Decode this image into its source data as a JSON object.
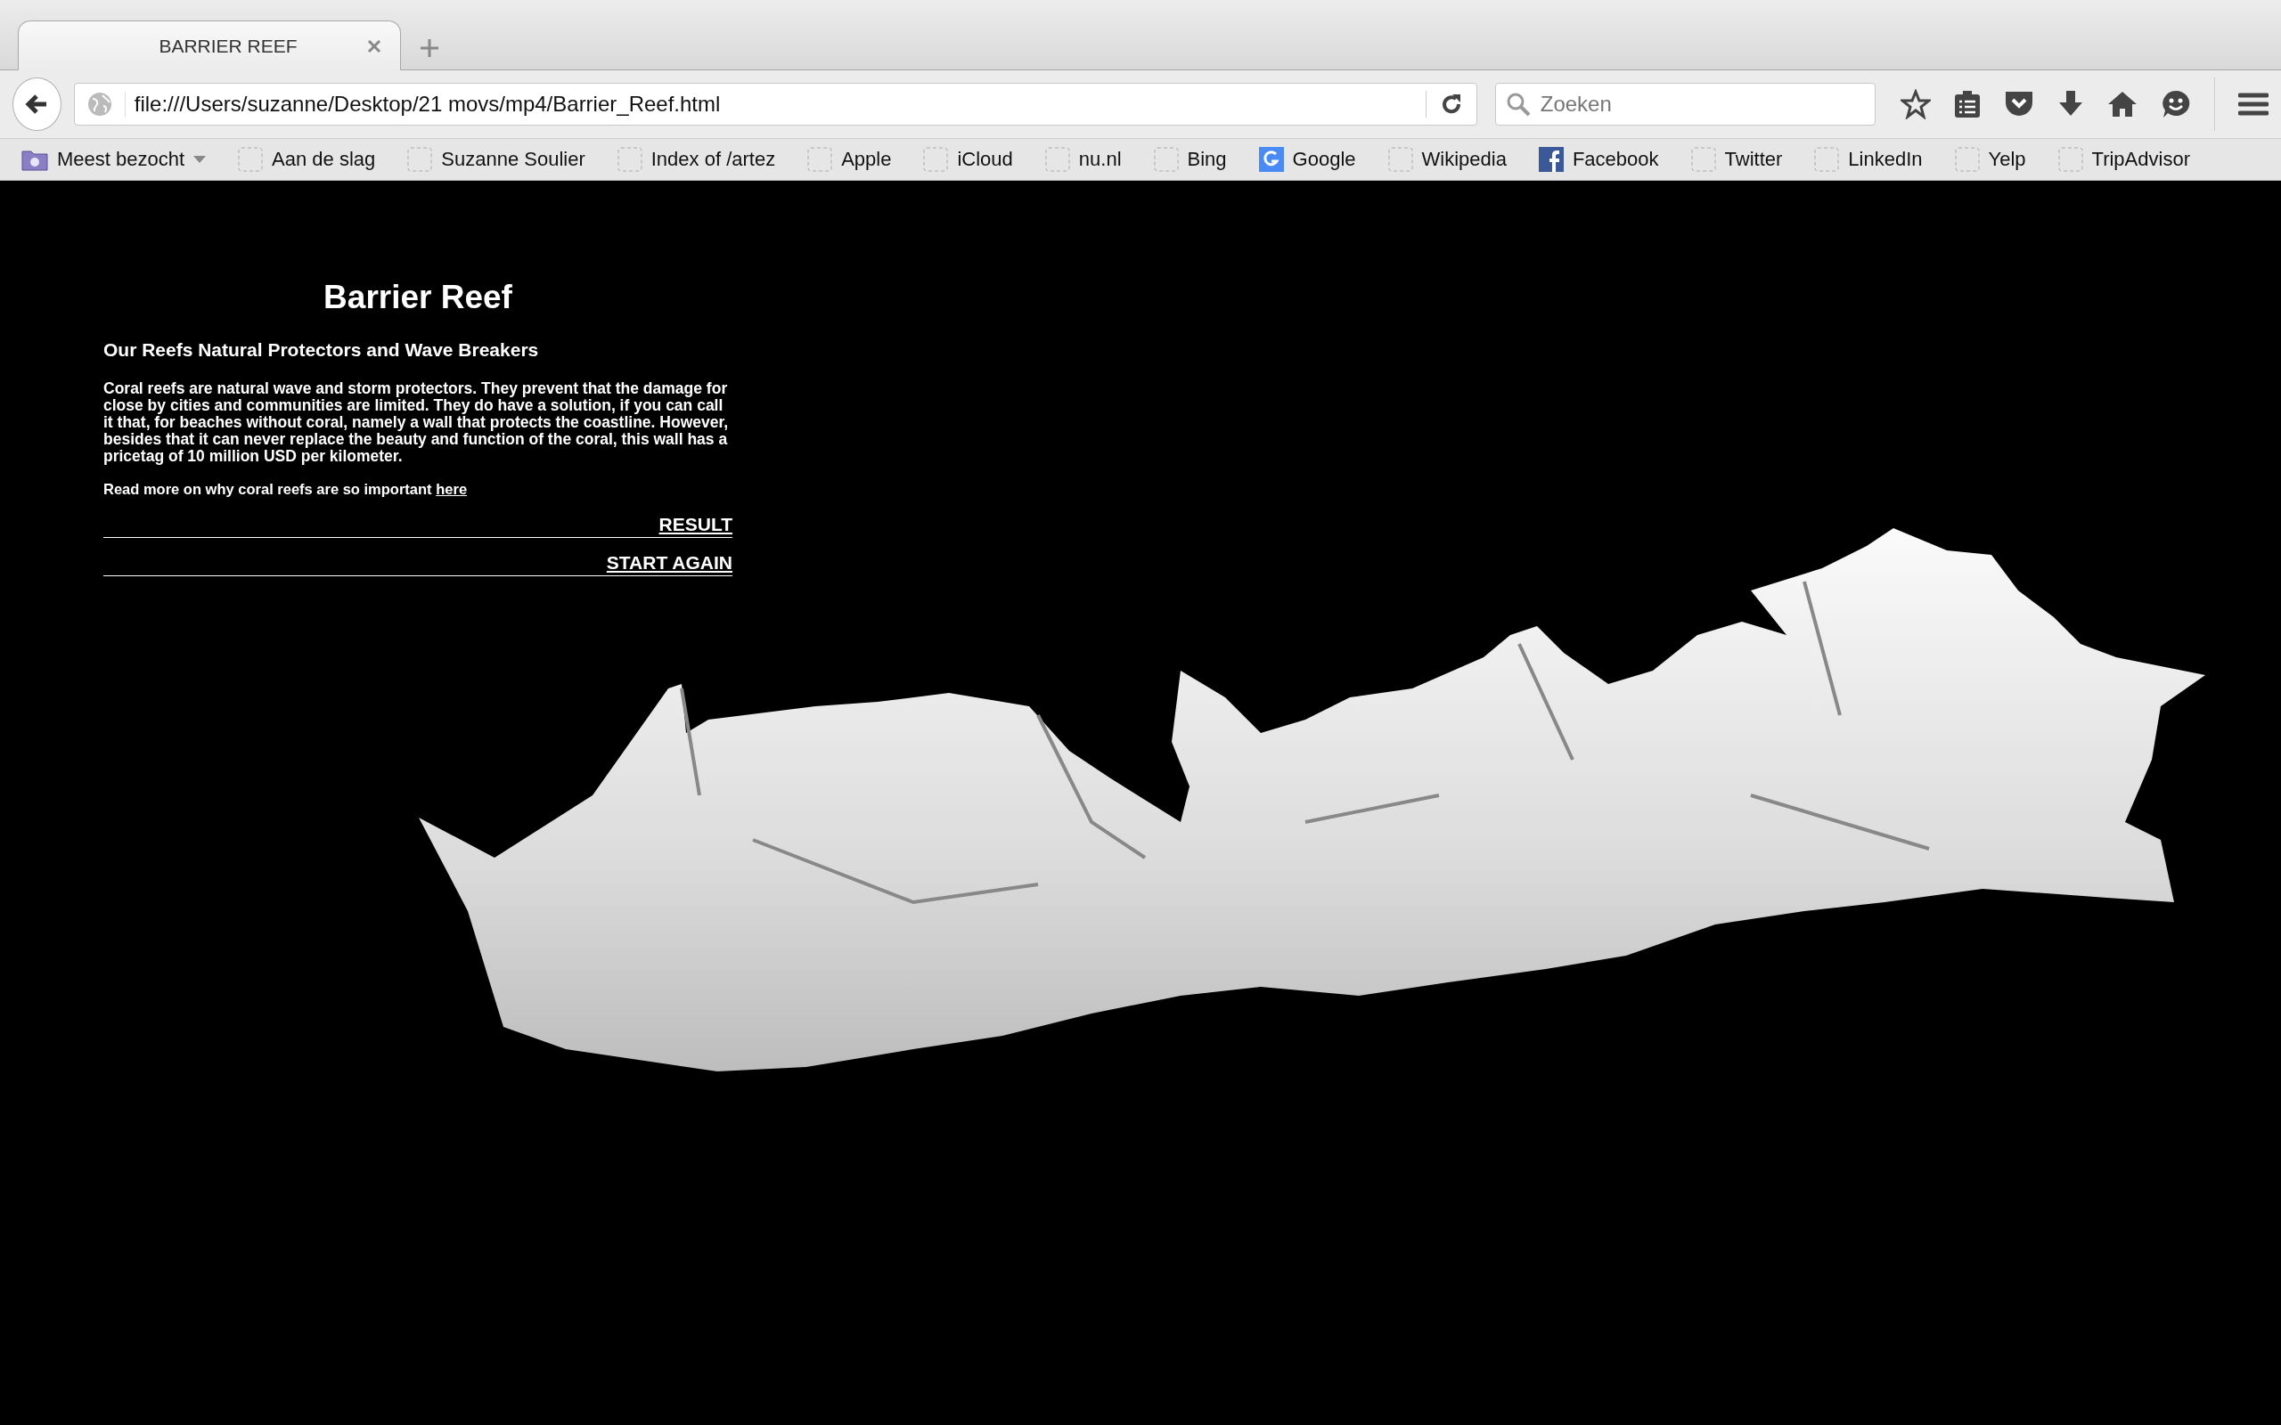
{
  "tab": {
    "title": "BARRIER REEF"
  },
  "address_bar": {
    "url": "file:///Users/suzanne/Desktop/21 movs/mp4/Barrier_Reef.html"
  },
  "search": {
    "placeholder": "Zoeken"
  },
  "bookmarks": [
    {
      "label": "Meest bezocht",
      "kind": "folder"
    },
    {
      "label": "Aan de slag",
      "kind": "blank"
    },
    {
      "label": "Suzanne Soulier",
      "kind": "blank"
    },
    {
      "label": "Index of /artez",
      "kind": "blank"
    },
    {
      "label": "Apple",
      "kind": "blank"
    },
    {
      "label": "iCloud",
      "kind": "blank"
    },
    {
      "label": "nu.nl",
      "kind": "blank"
    },
    {
      "label": "Bing",
      "kind": "blank"
    },
    {
      "label": "Google",
      "kind": "google"
    },
    {
      "label": "Wikipedia",
      "kind": "blank"
    },
    {
      "label": "Facebook",
      "kind": "facebook"
    },
    {
      "label": "Twitter",
      "kind": "blank"
    },
    {
      "label": "LinkedIn",
      "kind": "blank"
    },
    {
      "label": "Yelp",
      "kind": "blank"
    },
    {
      "label": "TripAdvisor",
      "kind": "blank"
    }
  ],
  "page": {
    "title": "Barrier Reef",
    "subtitle": "Our Reefs Natural Protectors and Wave Breakers",
    "body": "Coral reefs are natural wave and storm protectors. They prevent that the damage for close by cities and communities are limited. They do have a solution, if you can call it that, for beaches without coral, namely a wall that protects the coastline. However, besides that it can never replace the beauty and function of the coral, this wall has a pricetag of 10 million USD per kilometer.",
    "read_more": {
      "text": "Read more on why coral reefs are so important",
      "link": "here"
    },
    "actions": [
      "RESULT",
      "START AGAIN"
    ]
  }
}
